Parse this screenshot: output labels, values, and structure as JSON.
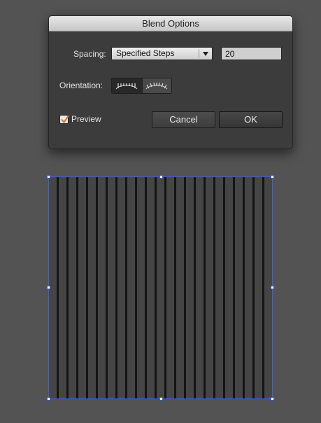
{
  "dialog": {
    "title": "Blend Options",
    "spacing_label": "Spacing:",
    "spacing_value": "Specified Steps",
    "steps_value": "20",
    "orientation_label": "Orientation:",
    "orientation_options": [
      {
        "icon": "align-to-page-icon",
        "selected": true
      },
      {
        "icon": "align-to-path-icon",
        "selected": false
      }
    ],
    "preview_label": "Preview",
    "preview_checked": true,
    "cancel_label": "Cancel",
    "ok_label": "OK"
  },
  "artwork": {
    "stripe_count": 22,
    "colors": {
      "stripe": "#141414",
      "fill": "#454545",
      "selection": "#3f63d6",
      "checkmark": "#d8722a"
    }
  }
}
